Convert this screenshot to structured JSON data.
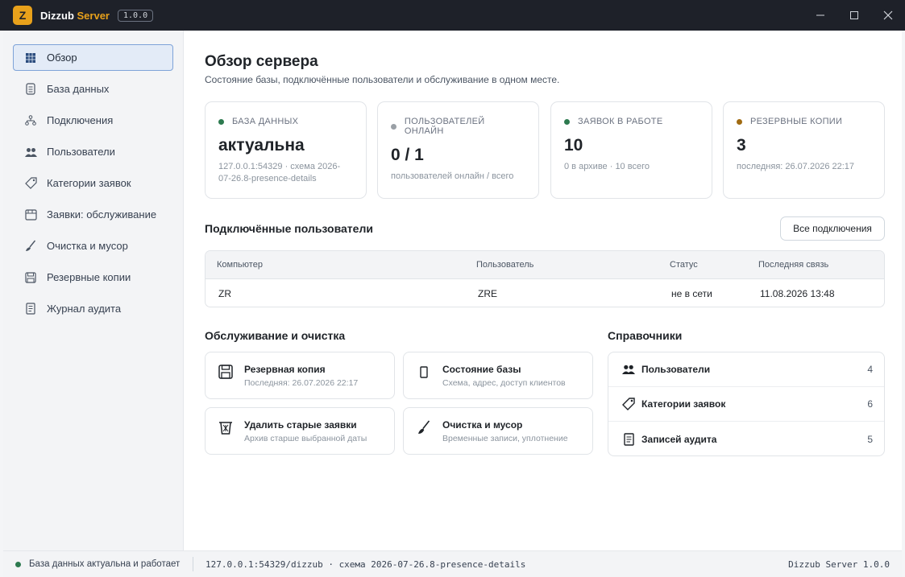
{
  "titlebar": {
    "logo_letter": "Z",
    "title_part1": "Dizzub",
    "title_part2": "Server",
    "version": "1.0.0",
    "minimize": "—",
    "maximize": "☐",
    "close": "✕"
  },
  "colors": {
    "accent": "#e8a11b",
    "green": "#2d7a4f",
    "gray": "#9aa0a6",
    "brown": "#a06b12",
    "active_nav": "#e3ebf7"
  },
  "sidebar": {
    "items": [
      {
        "label": "Обзор",
        "icon": "grid-icon"
      },
      {
        "label": "База данных",
        "icon": "database-icon"
      },
      {
        "label": "Подключения",
        "icon": "network-icon"
      },
      {
        "label": "Пользователи",
        "icon": "users-icon"
      },
      {
        "label": "Категории заявок",
        "icon": "tag-icon"
      },
      {
        "label": "Заявки: обслуживание",
        "icon": "archive-icon"
      },
      {
        "label": "Очистка и мусор",
        "icon": "brush-icon"
      },
      {
        "label": "Резервные копии",
        "icon": "save-icon"
      },
      {
        "label": "Журнал аудита",
        "icon": "scroll-icon"
      }
    ]
  },
  "main": {
    "title": "Обзор сервера",
    "subtitle": "Состояние базы, подключённые пользователи и обслуживание в одном месте.",
    "stats": [
      {
        "label": "База данных",
        "value": "актуальна",
        "sub": "127.0.0.1:54329 · схема 2026-07-26.8-presence-details",
        "dot": "#2d7a4f"
      },
      {
        "label": "Пользователей онлайн",
        "value": "0 / 1",
        "sub": "пользователей онлайн / всего",
        "dot": "#9aa0a6"
      },
      {
        "label": "Заявок в работе",
        "value": "10",
        "sub": "0 в архиве · 10 всего",
        "dot": "#2d7a4f"
      },
      {
        "label": "Резервные копии",
        "value": "3",
        "sub": "последняя: 26.07.2026 22:17",
        "dot": "#a06b12"
      }
    ],
    "connected": {
      "title": "Подключённые пользователи",
      "all_button": "Все подключения",
      "columns": [
        "Компьютер",
        "Пользователь",
        "Статус",
        "Последняя связь"
      ],
      "rows": [
        {
          "computer": "ZR",
          "user": "ZRE",
          "status": "не в сети",
          "last_seen": "11.08.2026 13:48"
        }
      ]
    },
    "maintenance": {
      "title": "Обслуживание и очистка",
      "actions": [
        {
          "title": "Резервная копия",
          "sub": "Последняя: 26.07.2026 22:17",
          "icon": "save-icon"
        },
        {
          "title": "Состояние базы",
          "sub": "Схема, адрес, доступ клиентов",
          "icon": "database-icon"
        },
        {
          "title": "Удалить старые заявки",
          "sub": "Архив старше выбранной даты",
          "icon": "trash-icon"
        },
        {
          "title": "Очистка и мусор",
          "sub": "Временные записи, уплотнение",
          "icon": "brush-icon"
        }
      ]
    },
    "references": {
      "title": "Справочники",
      "items": [
        {
          "label": "Пользователи",
          "count": "4",
          "icon": "users-icon"
        },
        {
          "label": "Категории заявок",
          "count": "6",
          "icon": "tag-icon"
        },
        {
          "label": "Записей аудита",
          "count": "5",
          "icon": "scroll-icon"
        }
      ]
    }
  },
  "statusbar": {
    "db_status": "База данных актуальна и работает",
    "connection": "127.0.0.1:54329/dizzub · схема 2026-07-26.8-presence-details",
    "app_version": "Dizzub Server 1.0.0"
  }
}
